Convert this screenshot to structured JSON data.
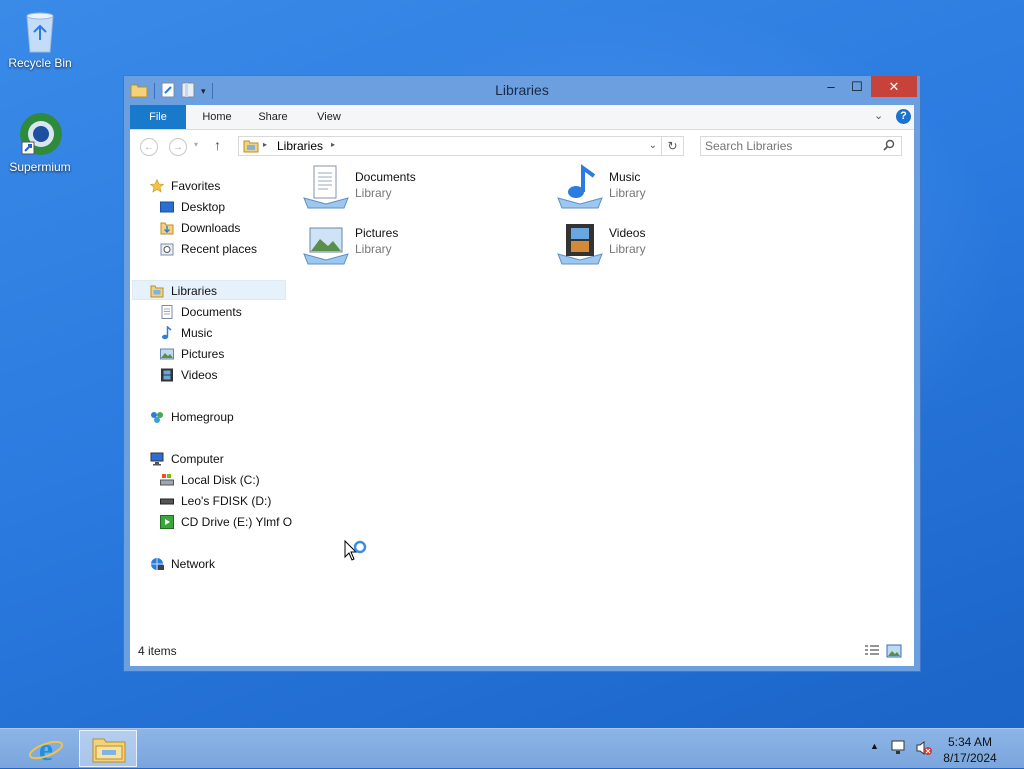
{
  "desktop": {
    "icons": [
      {
        "label": "Recycle Bin",
        "icon": "recycle-bin-icon"
      },
      {
        "label": "Supermium",
        "icon": "supermium-browser-icon"
      }
    ]
  },
  "window": {
    "title": "Libraries",
    "controls": {
      "minimize": "–",
      "maximize": "☐",
      "close": "✕"
    },
    "ribbon_tabs": [
      "File",
      "Home",
      "Share",
      "View"
    ],
    "address": {
      "location_icon": "libraries-folder-icon",
      "path": [
        "Libraries"
      ]
    },
    "search": {
      "placeholder": "Search Libraries"
    },
    "navigation": {
      "favorites": {
        "label": "Favorites",
        "items": [
          "Desktop",
          "Downloads",
          "Recent places"
        ]
      },
      "libraries": {
        "label": "Libraries",
        "items": [
          "Documents",
          "Music",
          "Pictures",
          "Videos"
        ]
      },
      "homegroup": {
        "label": "Homegroup"
      },
      "computer": {
        "label": "Computer",
        "items": [
          "Local Disk (C:)",
          "Leo's FDISK (D:)",
          "CD Drive (E:) Ylmf O"
        ]
      },
      "network": {
        "label": "Network"
      }
    },
    "libraries": [
      {
        "name": "Documents",
        "type": "Library",
        "icon": "documents-library-icon"
      },
      {
        "name": "Music",
        "type": "Library",
        "icon": "music-library-icon"
      },
      {
        "name": "Pictures",
        "type": "Library",
        "icon": "pictures-library-icon"
      },
      {
        "name": "Videos",
        "type": "Library",
        "icon": "videos-library-icon"
      }
    ],
    "status": "4 items"
  },
  "taskbar": {
    "time": "5:34 AM",
    "date": "8/17/2024",
    "apps": [
      "internet-explorer-icon",
      "file-explorer-icon"
    ]
  },
  "colors": {
    "accent": "#1979ca",
    "close_button": "#c7423a",
    "window_frame": "#6b9fe0",
    "desktop": "#2b7be0"
  }
}
